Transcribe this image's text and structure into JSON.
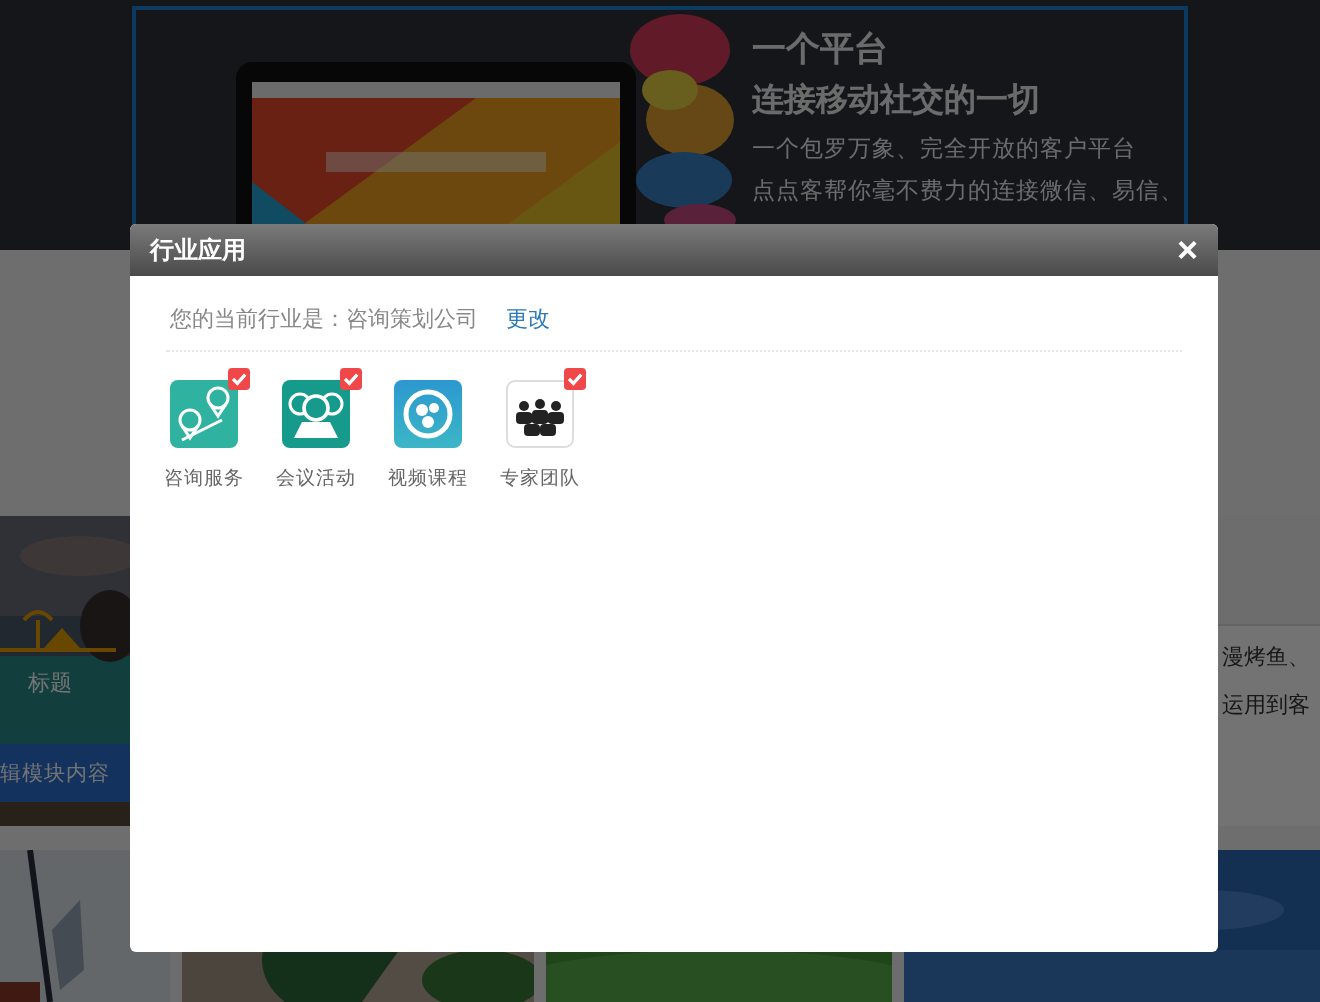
{
  "hero": {
    "heading": "一个平台",
    "subheading": "连接移动社交的一切",
    "lines": [
      "一个包罗万象、完全开放的客户平台",
      "点点客帮你毫不费力的连接微信、易信、"
    ]
  },
  "module": {
    "title": "标题",
    "bar": "辑模块内容"
  },
  "side_text": [
    "漫烤鱼、",
    "运用到客"
  ],
  "dialog": {
    "title": "行业应用",
    "close": "×",
    "industry_label": "您的当前行业是：咨询策划公司",
    "change_link": "更改",
    "apps": [
      {
        "kind": "route",
        "label": "咨询服务",
        "selected": true
      },
      {
        "kind": "meeting",
        "label": "会议活动",
        "selected": true
      },
      {
        "kind": "video",
        "label": "视频课程",
        "selected": false
      },
      {
        "kind": "team",
        "label": "专家团队",
        "selected": true
      }
    ]
  }
}
